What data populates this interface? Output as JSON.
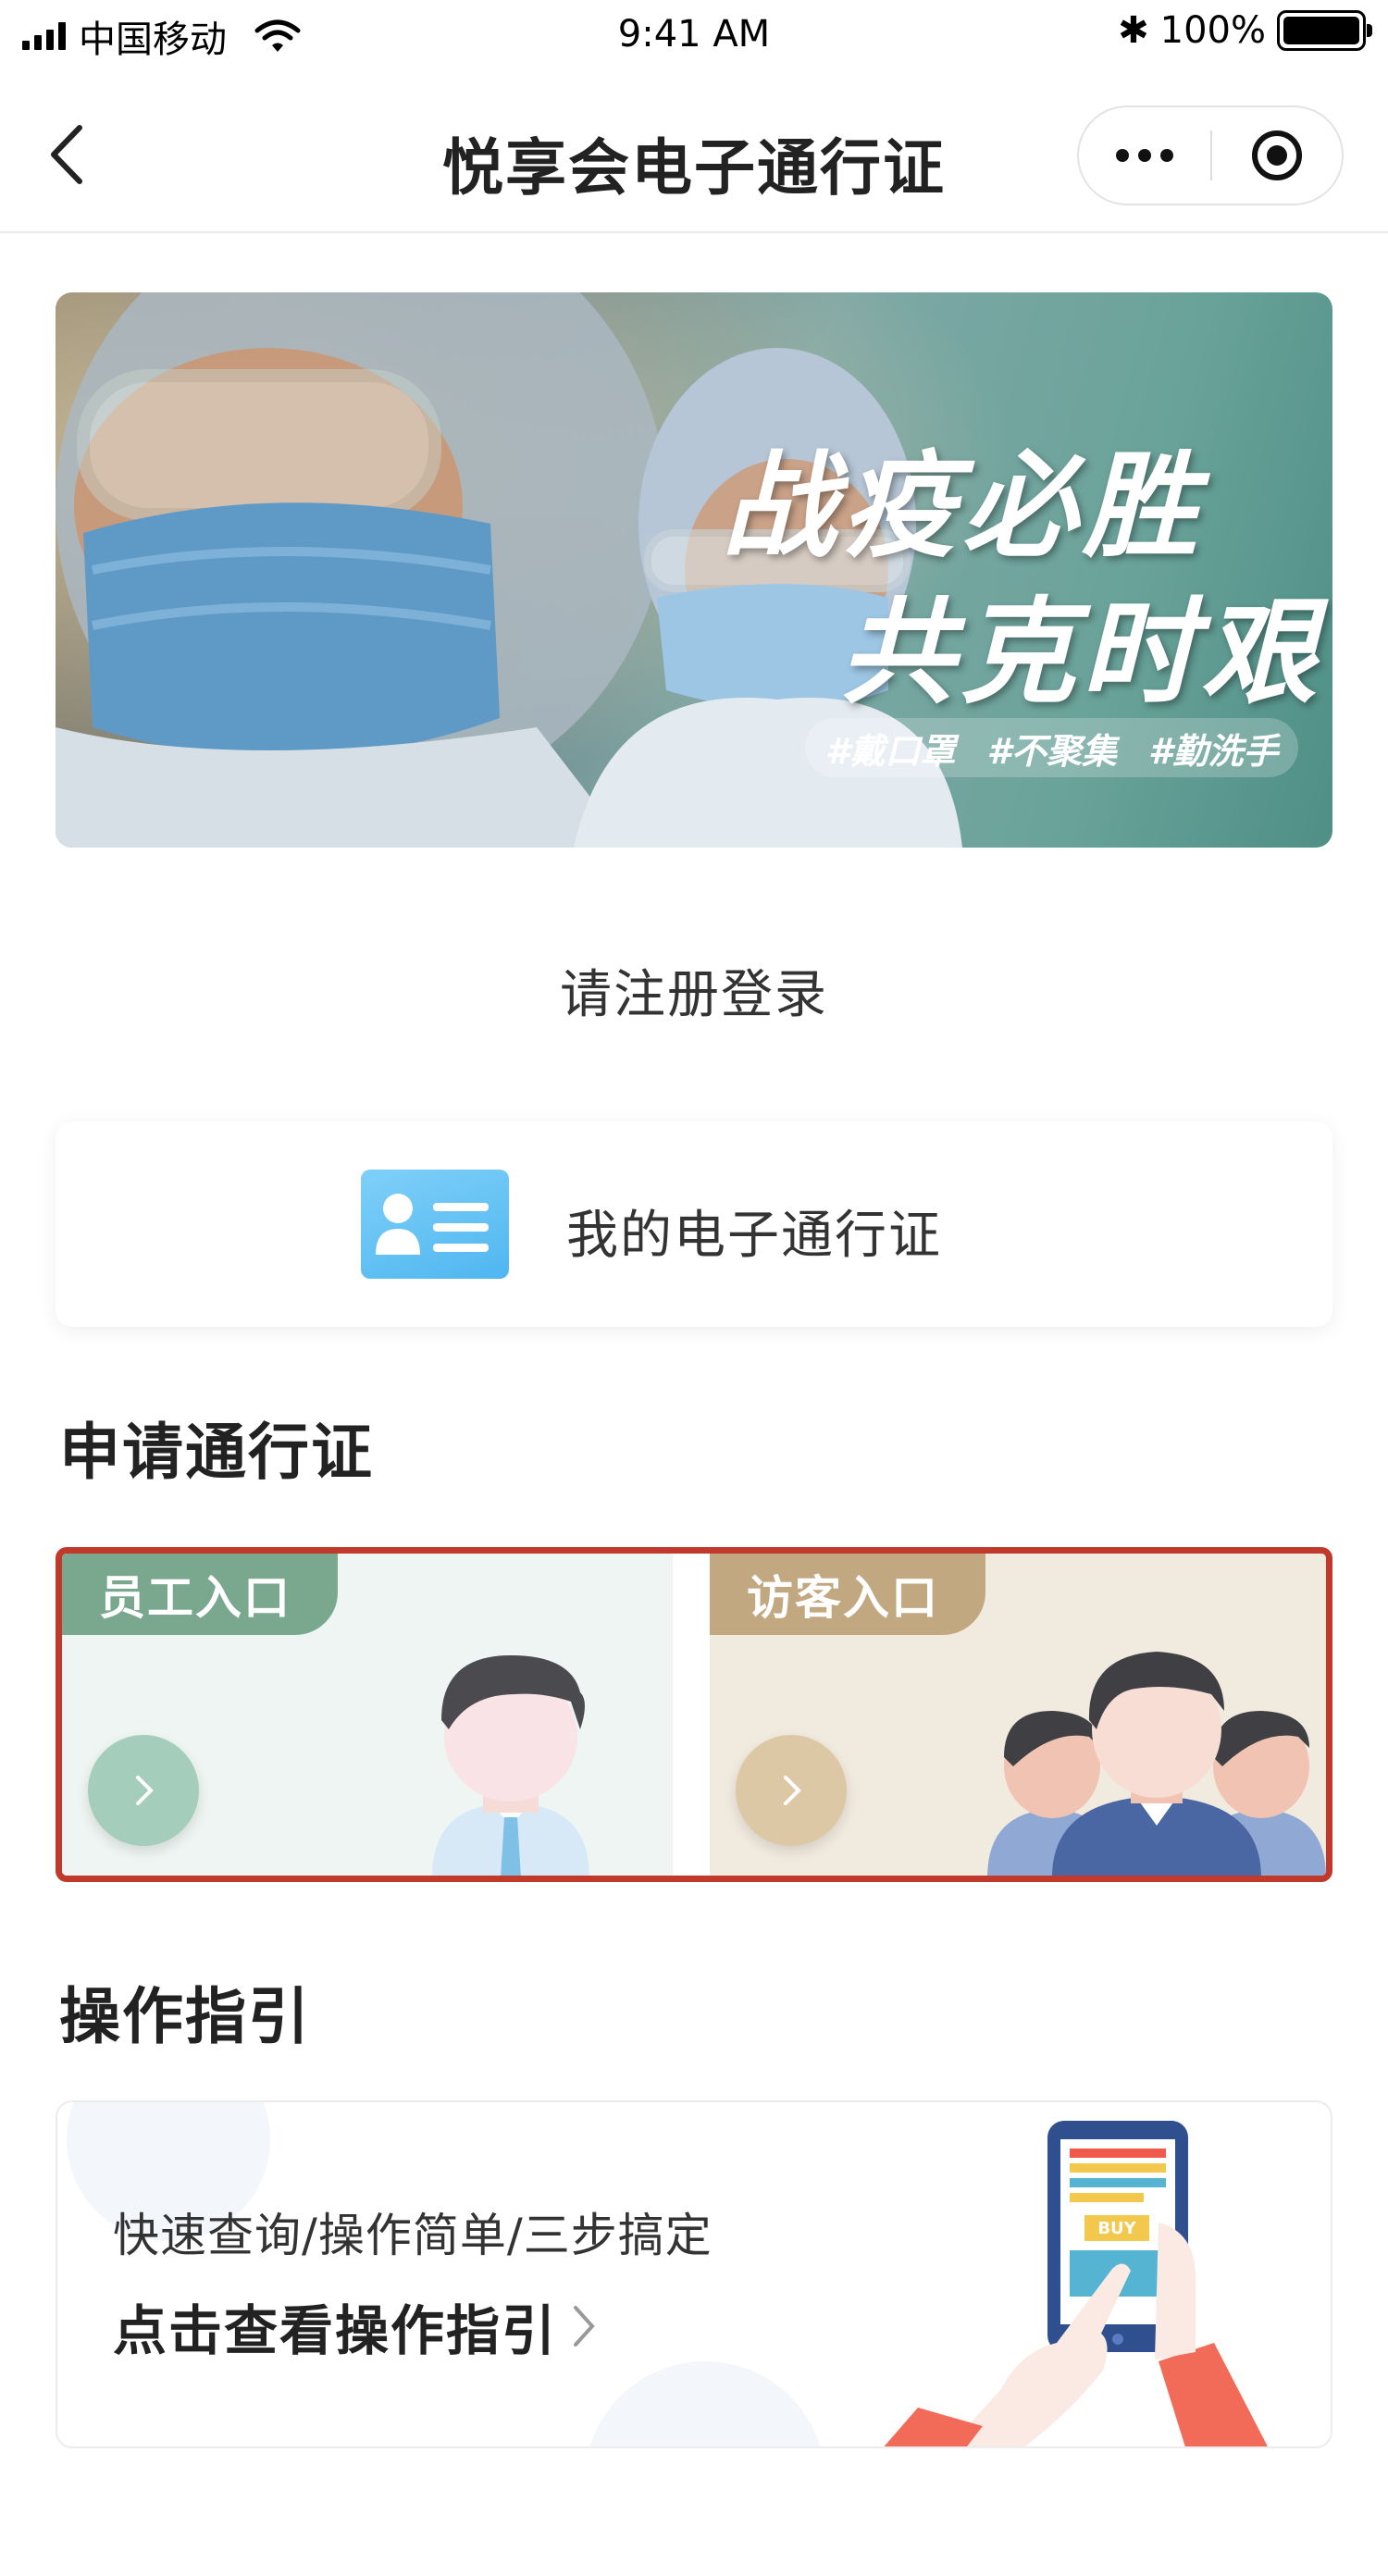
{
  "status_bar": {
    "carrier": "中国移动",
    "time": "9:41 AM",
    "battery": "100%"
  },
  "nav": {
    "title": "悦享会电子通行证"
  },
  "banner": {
    "line1": "战疫必胜",
    "line2": "共克时艰",
    "tags": [
      "#戴口罩",
      "#不聚集",
      "#勤洗手"
    ]
  },
  "register": {
    "text": "请注册登录"
  },
  "my_pass": {
    "label": "我的电子通行证"
  },
  "apply_section": {
    "title": "申请通行证",
    "staff_label": "员工入口",
    "visitor_label": "访客入口"
  },
  "guide_section": {
    "title": "操作指引",
    "subtitle": "快速查询/操作简单/三步搞定",
    "link_text": "点击查看操作指引",
    "illustration_text": "BUY"
  },
  "colors": {
    "highlight_border": "#c0392b",
    "staff_tag": "#7aa88f",
    "visitor_tag": "#c2a881",
    "id_icon": "#4fb6f0"
  }
}
